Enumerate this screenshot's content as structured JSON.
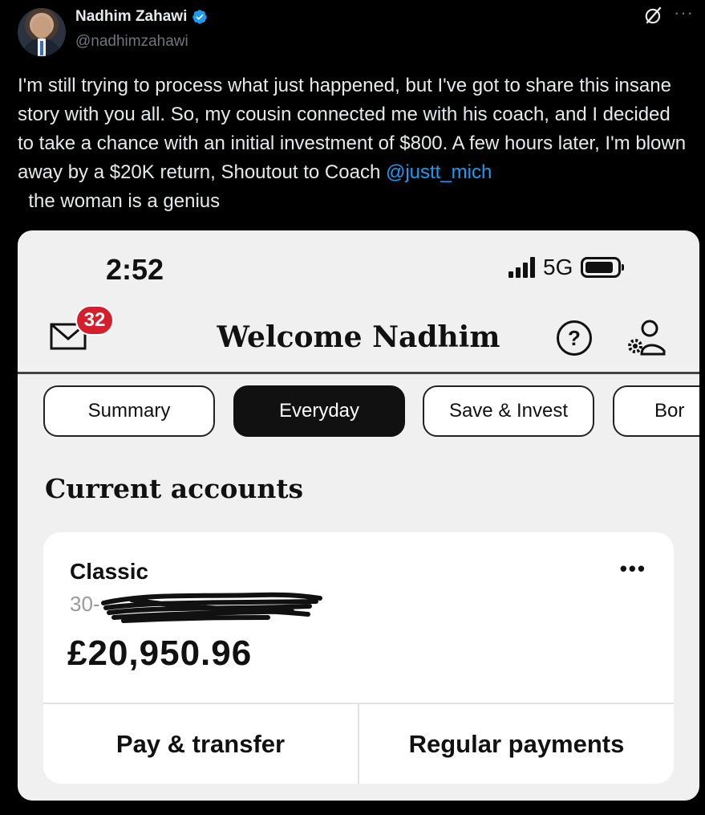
{
  "tweet": {
    "author_name": "Nadhim Zahawi",
    "handle": "@nadhimzahawi",
    "text_before_mention": "I'm still trying to process what just happened, but I've got to share this insane story with you all. So, my cousin connected me with his coach, and I decided to take a chance with an initial investment of $800. A few hours later, I'm blown away by a $20K return, Shoutout to Coach ",
    "mention": "@justt_mich",
    "text_after_mention": "  the woman is a genius",
    "more_label": "···",
    "icons": [
      "verified-badge-icon",
      "grok-icon",
      "more-icon"
    ],
    "colors": {
      "background": "#000000",
      "text": "#e7e9ea",
      "secondary": "#71767b",
      "link": "#1d9bf0",
      "verified": "#1d9bf0"
    }
  },
  "phone": {
    "status_bar": {
      "time": "2:52",
      "network": "5G"
    },
    "header": {
      "mail_badge": "32",
      "welcome": "Welcome Nadhim",
      "help_label": "?"
    },
    "tabs": [
      {
        "label": "Summary",
        "active": false
      },
      {
        "label": "Everyday",
        "active": true
      },
      {
        "label": "Save & Invest",
        "active": false
      },
      {
        "label": "Bor",
        "active": false
      }
    ],
    "section_title": "Current accounts",
    "account": {
      "name": "Classic",
      "sort_code_visible": "30-",
      "menu_label": "•••",
      "balance": "£20,950.96",
      "actions": [
        "Pay & transfer",
        "Regular payments"
      ]
    },
    "colors": {
      "badge": "#d4202c",
      "background": "#f0f0f0",
      "card": "#ffffff"
    }
  }
}
